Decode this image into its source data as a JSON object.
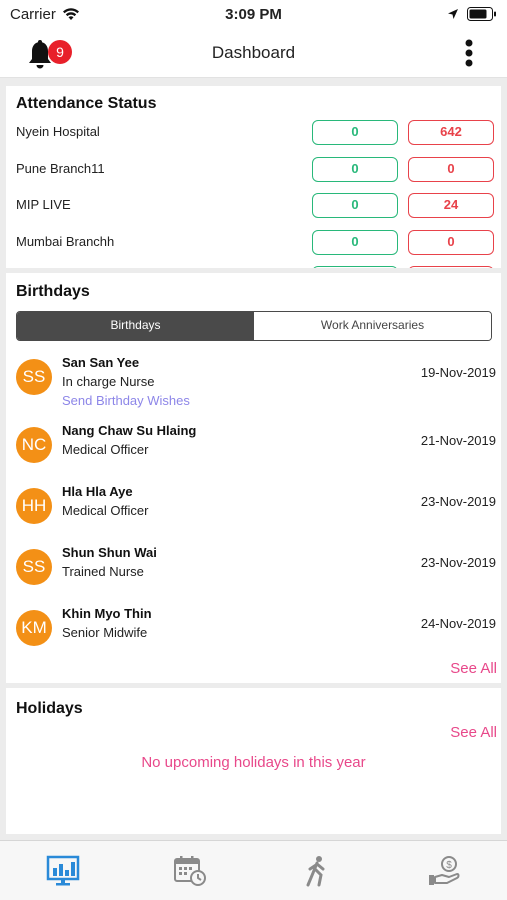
{
  "status_bar": {
    "carrier": "Carrier",
    "time": "3:09 PM"
  },
  "header": {
    "title": "Dashboard",
    "notification_count": "9"
  },
  "attendance": {
    "title": "Attendance Status",
    "rows": [
      {
        "name": "Nyein Hospital",
        "present": "0",
        "absent": "642"
      },
      {
        "name": "Pune Branch11",
        "present": "0",
        "absent": "0"
      },
      {
        "name": "MIP LIVE",
        "present": "0",
        "absent": "24"
      },
      {
        "name": "Mumbai Branchh",
        "present": "0",
        "absent": "0"
      }
    ]
  },
  "birthdays": {
    "title": "Birthdays",
    "tabs": [
      "Birthdays",
      "Work Anniversaries"
    ],
    "people": [
      {
        "initials": "SS",
        "name": "San San Yee",
        "role": "In charge Nurse",
        "date": "19-Nov-2019",
        "action": "Send Birthday Wishes"
      },
      {
        "initials": "NC",
        "name": "Nang Chaw Su Hlaing",
        "role": "Medical Officer",
        "date": "21-Nov-2019"
      },
      {
        "initials": "HH",
        "name": "Hla Hla Aye",
        "role": "Medical Officer",
        "date": "23-Nov-2019"
      },
      {
        "initials": "SS",
        "name": "Shun Shun Wai",
        "role": "Trained Nurse",
        "date": "23-Nov-2019"
      },
      {
        "initials": "KM",
        "name": "Khin Myo Thin",
        "role": "Senior Midwife",
        "date": "24-Nov-2019"
      }
    ],
    "see_all": "See All"
  },
  "holidays": {
    "title": "Holidays",
    "see_all": "See All",
    "empty_message": "No upcoming holidays in this year"
  },
  "tab_bar": {
    "tabs": [
      {
        "icon": "dashboard-chart-icon",
        "active": true
      },
      {
        "icon": "calendar-clock-icon",
        "active": false
      },
      {
        "icon": "walking-person-icon",
        "active": false
      },
      {
        "icon": "hand-money-icon",
        "active": false
      }
    ]
  },
  "colors": {
    "accent_blue": "#2a8ad8",
    "present_green": "#28b87a",
    "absent_red": "#e8424a",
    "avatar_orange": "#f39016",
    "link_pink": "#e8488a",
    "wish_purple": "#8d86e8"
  }
}
